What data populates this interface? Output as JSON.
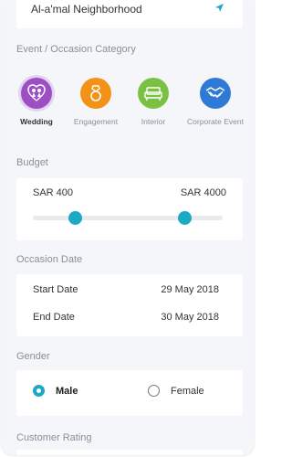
{
  "location": {
    "value": "Al-a'mal Neighborhood",
    "icon": "navigation-arrow-icon"
  },
  "category": {
    "label": "Event / Occasion Category",
    "items": [
      {
        "label": "Wedding",
        "icon": "wedding-couple-icon",
        "color": "#9b4fc2",
        "selected": true
      },
      {
        "label": "Engagement",
        "icon": "ring-icon",
        "color": "#f39217",
        "selected": false
      },
      {
        "label": "Interior",
        "icon": "sofa-icon",
        "color": "#7ac143",
        "selected": false
      },
      {
        "label": "Corporate Event",
        "icon": "handshake-icon",
        "color": "#2f7ad6",
        "selected": false
      }
    ]
  },
  "budget": {
    "label": "Budget",
    "min_label": "SAR 400",
    "max_label": "SAR 4000",
    "range_low_fraction": 0.22,
    "range_high_fraction": 0.8,
    "accent_color": "#1ba9c4"
  },
  "date": {
    "label": "Occasion  Date",
    "start_label": "Start Date",
    "start_value": "29 May 2018",
    "end_label": "End Date",
    "end_value": "30 May 2018"
  },
  "gender": {
    "label": "Gender",
    "options": [
      {
        "label": "Male",
        "selected": true
      },
      {
        "label": "Female",
        "selected": false
      }
    ]
  },
  "rating": {
    "label": "Customer Rating"
  }
}
